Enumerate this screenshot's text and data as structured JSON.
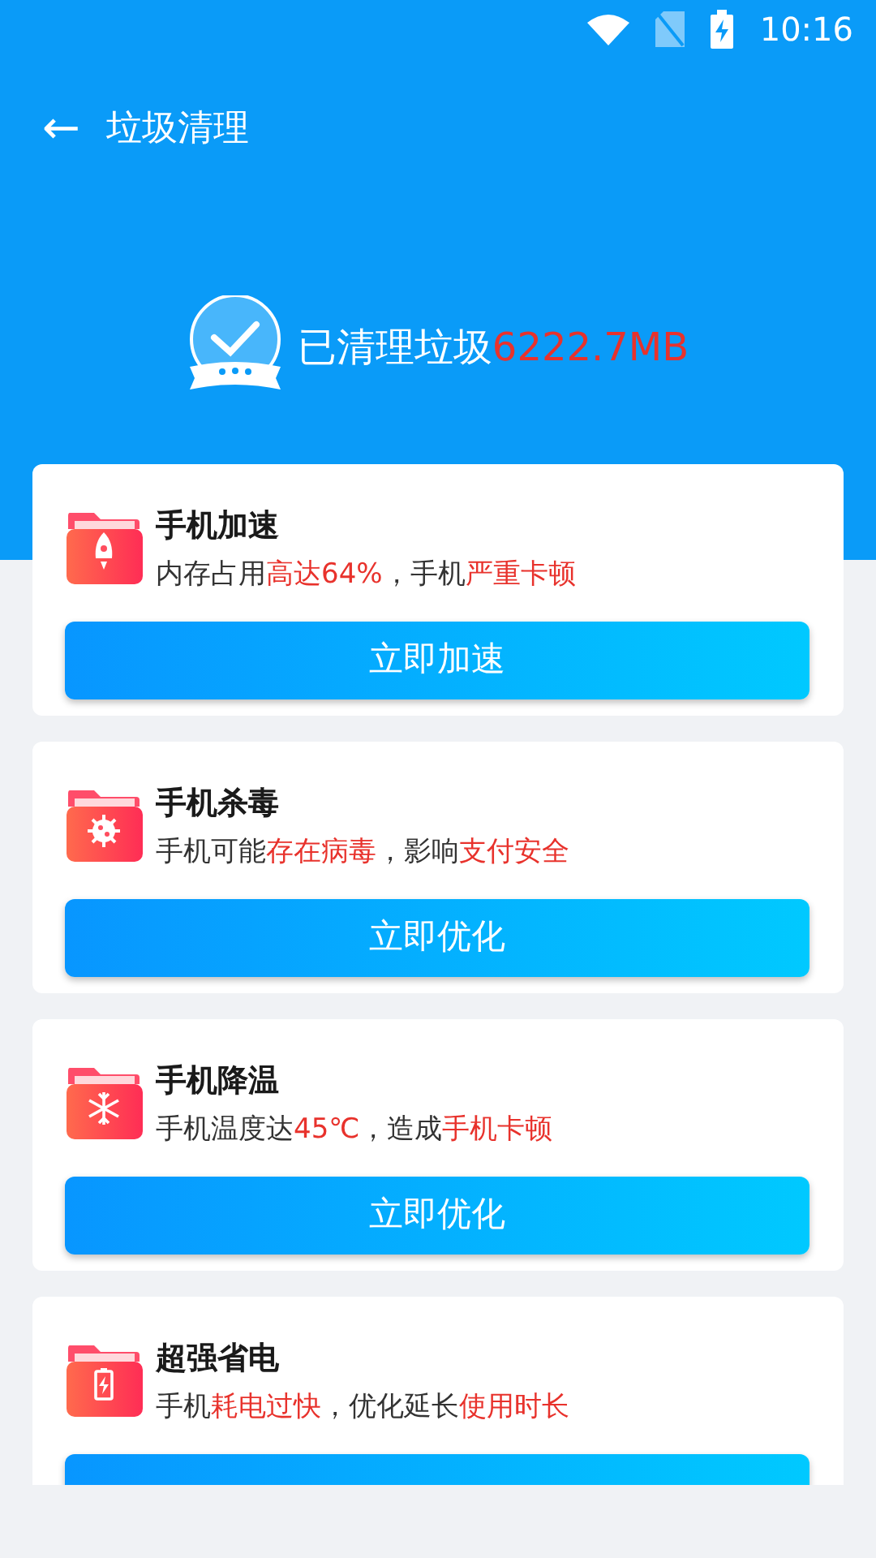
{
  "status_bar": {
    "time": "10:16"
  },
  "header": {
    "back": "←",
    "title": "垃圾清理"
  },
  "summary": {
    "label": "已清理垃圾",
    "amount": "6222.7MB"
  },
  "cards": [
    {
      "kind": "rocket",
      "title": "手机加速",
      "parts": [
        {
          "text": "内存占用",
          "highlight": false
        },
        {
          "text": "高达64%",
          "highlight": true
        },
        {
          "text": "，手机",
          "highlight": false
        },
        {
          "text": "严重卡顿",
          "highlight": true
        }
      ],
      "button": "立即加速"
    },
    {
      "kind": "virus",
      "title": "手机杀毒",
      "parts": [
        {
          "text": "手机可能",
          "highlight": false
        },
        {
          "text": "存在病毒",
          "highlight": true
        },
        {
          "text": "，影响",
          "highlight": false
        },
        {
          "text": "支付安全",
          "highlight": true
        }
      ],
      "button": "立即优化"
    },
    {
      "kind": "snowflake",
      "title": "手机降温",
      "parts": [
        {
          "text": "手机温度达",
          "highlight": false
        },
        {
          "text": "45℃",
          "highlight": true
        },
        {
          "text": "，造成",
          "highlight": false
        },
        {
          "text": "手机卡顿",
          "highlight": true
        }
      ],
      "button": "立即优化"
    },
    {
      "kind": "battery",
      "title": "超强省电",
      "parts": [
        {
          "text": "手机",
          "highlight": false
        },
        {
          "text": "耗电过快",
          "highlight": true
        },
        {
          "text": "，优化延长",
          "highlight": false
        },
        {
          "text": "使用时长",
          "highlight": true
        }
      ]
    }
  ]
}
